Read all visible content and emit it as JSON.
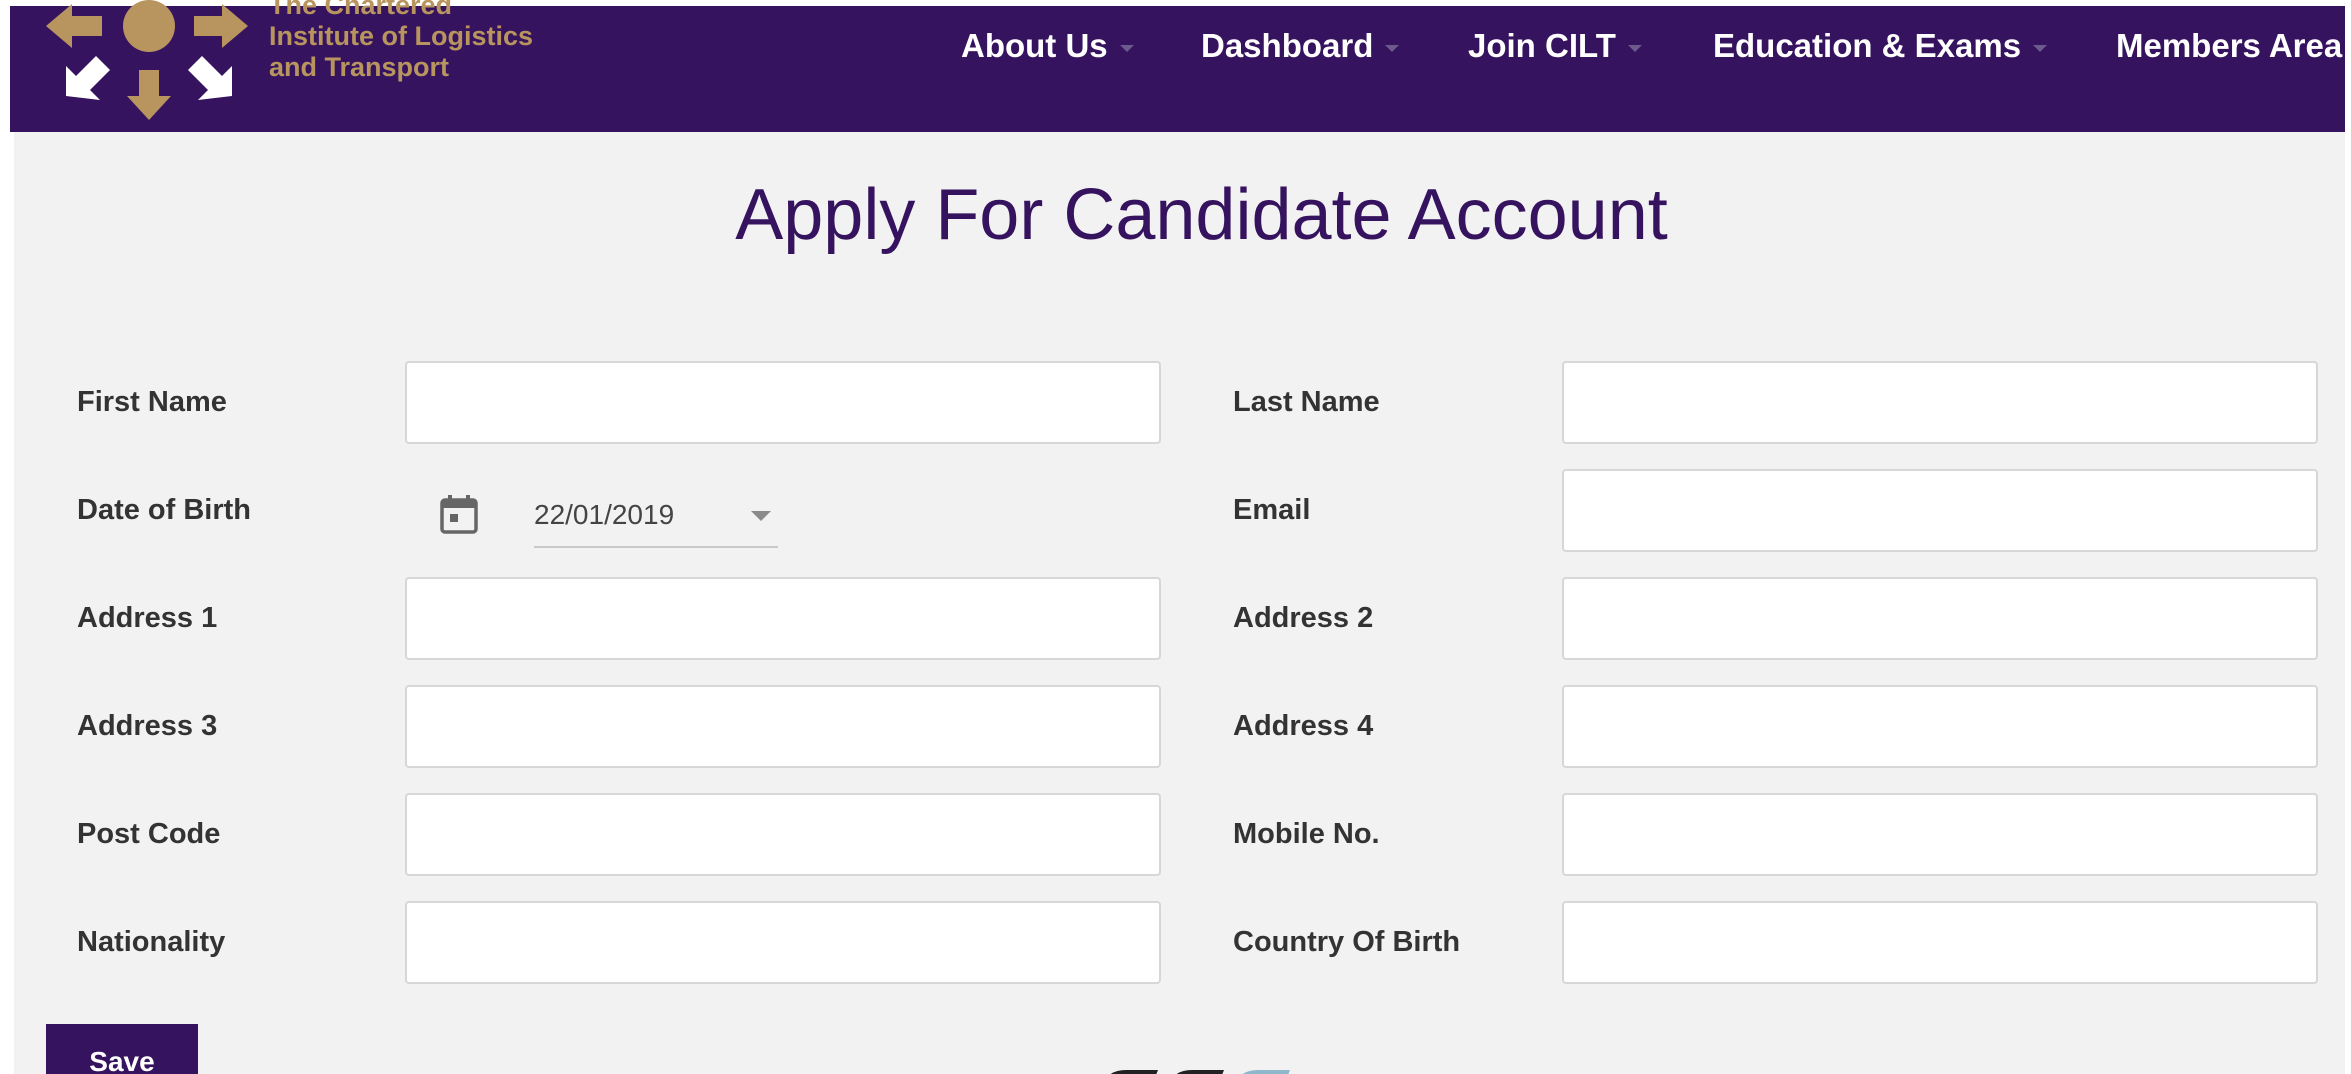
{
  "header": {
    "logo_lines": [
      "The Chartered",
      "Institute of Logistics",
      "and Transport"
    ],
    "nav": [
      {
        "label": "About Us",
        "has_dropdown": true
      },
      {
        "label": "Dashboard",
        "has_dropdown": true
      },
      {
        "label": "Join CILT",
        "has_dropdown": true
      },
      {
        "label": "Education & Exams",
        "has_dropdown": true
      },
      {
        "label": "Members Area",
        "has_dropdown": true
      }
    ]
  },
  "page_title": "Apply For Candidate Account",
  "form": {
    "first_name_label": "First Name",
    "last_name_label": "Last Name",
    "dob_label": "Date of Birth",
    "dob_value": "22/01/2019",
    "email_label": "Email",
    "address1_label": "Address 1",
    "address2_label": "Address 2",
    "address3_label": "Address 3",
    "address4_label": "Address 4",
    "postcode_label": "Post Code",
    "mobile_label": "Mobile No.",
    "nationality_label": "Nationality",
    "country_of_birth_label": "Country Of Birth",
    "values": {
      "first_name": "",
      "last_name": "",
      "email": "",
      "address1": "",
      "address2": "",
      "address3": "",
      "address4": "",
      "postcode": "",
      "mobile": "",
      "nationality": "",
      "country_of_birth": ""
    },
    "save_label": "Save"
  },
  "colors": {
    "brand_purple": "#36135f",
    "logo_gold": "#b8955e",
    "page_background": "#f2f2f2"
  },
  "icons": [
    "logo-arrows-icon",
    "calendar-icon",
    "chevron-down-icon"
  ]
}
